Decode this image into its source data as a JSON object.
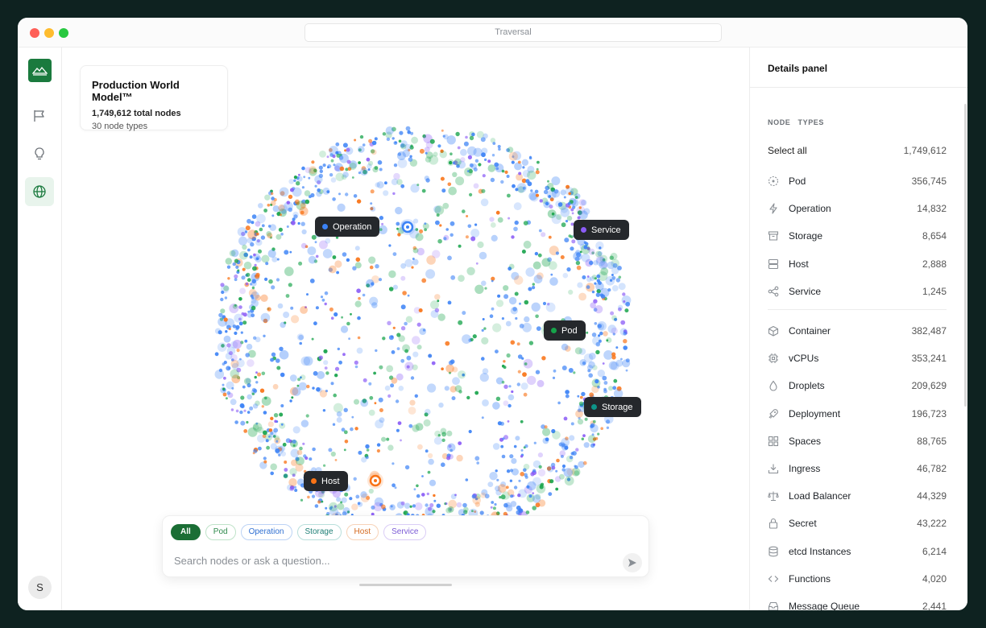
{
  "window": {
    "url_title": "Traversal"
  },
  "rail": {
    "avatar_initial": "S"
  },
  "info_card": {
    "title": "Production World Model™",
    "total": "1,749,612 total nodes",
    "types": "30 node types"
  },
  "graph": {
    "labels": [
      {
        "text": "Operation",
        "color": "#3b82f6"
      },
      {
        "text": "Service",
        "color": "#8b5cf6"
      },
      {
        "text": "Pod",
        "color": "#16a34a"
      },
      {
        "text": "Storage",
        "color": "#0d9488"
      },
      {
        "text": "Host",
        "color": "#f97316"
      }
    ]
  },
  "search": {
    "chips": [
      "All",
      "Pod",
      "Operation",
      "Storage",
      "Host",
      "Service"
    ],
    "placeholder": "Search nodes or ask a question..."
  },
  "panel": {
    "title": "Details panel",
    "section_label": "NODE TYPES",
    "select_all": {
      "label": "Select all",
      "count": "1,749,612"
    },
    "group1": [
      {
        "name": "Pod",
        "count": "356,745",
        "icon": "pod-icon"
      },
      {
        "name": "Operation",
        "count": "14,832",
        "icon": "lightning-icon"
      },
      {
        "name": "Storage",
        "count": "8,654",
        "icon": "archive-icon"
      },
      {
        "name": "Host",
        "count": "2,888",
        "icon": "server-icon"
      },
      {
        "name": "Service",
        "count": "1,245",
        "icon": "share-icon"
      }
    ],
    "group2": [
      {
        "name": "Container",
        "count": "382,487",
        "icon": "cube-icon"
      },
      {
        "name": "vCPUs",
        "count": "353,241",
        "icon": "cpu-icon"
      },
      {
        "name": "Droplets",
        "count": "209,629",
        "icon": "droplet-icon"
      },
      {
        "name": "Deployment",
        "count": "196,723",
        "icon": "rocket-icon"
      },
      {
        "name": "Spaces",
        "count": "88,765",
        "icon": "grid-icon"
      },
      {
        "name": "Ingress",
        "count": "46,782",
        "icon": "download-icon"
      },
      {
        "name": "Load Balancer",
        "count": "44,329",
        "icon": "scale-icon"
      },
      {
        "name": "Secret",
        "count": "43,222",
        "icon": "lock-icon"
      },
      {
        "name": "etcd Instances",
        "count": "6,214",
        "icon": "database-icon"
      },
      {
        "name": "Functions",
        "count": "4,020",
        "icon": "code-icon"
      },
      {
        "name": "Message Queue",
        "count": "2,441",
        "icon": "inbox-icon"
      }
    ]
  },
  "colors": {
    "accent": "#1a7a3e",
    "blue": "#3b82f6",
    "green": "#16a34a",
    "orange": "#f97316",
    "violet": "#8b5cf6",
    "teal": "#0d9488"
  }
}
